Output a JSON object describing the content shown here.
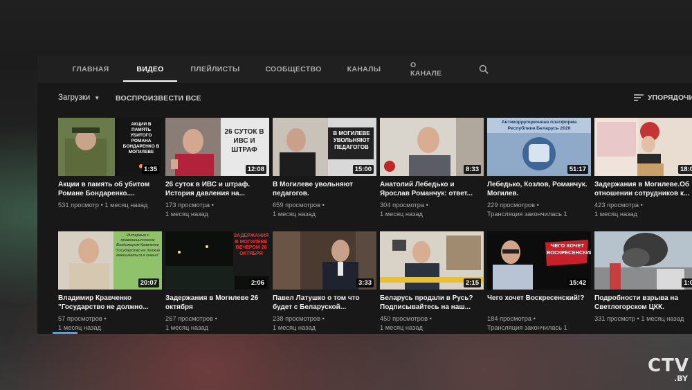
{
  "tabs": [
    {
      "label": "ГЛАВНАЯ",
      "active": false
    },
    {
      "label": "ВИДЕО",
      "active": true
    },
    {
      "label": "ПЛЕЙЛИСТЫ",
      "active": false
    },
    {
      "label": "СООБЩЕСТВО",
      "active": false
    },
    {
      "label": "КАНАЛЫ",
      "active": false
    },
    {
      "label": "О КАНАЛЕ",
      "active": false
    }
  ],
  "toolbar": {
    "uploads_label": "Загрузки",
    "play_all_label": "ВОСПРОИЗВЕСТИ ВСЕ",
    "sort_label": "УПОРЯДОЧИ"
  },
  "videos": [
    {
      "title": "Акции в память об убитом Романе Бондаренко....",
      "duration": "1:35",
      "meta1": "531 просмотр • 1 месяц назад",
      "meta2": "",
      "thumb_text": "Акции в память убитого РОМАНА БОНДАРЕНКО в Могилеве"
    },
    {
      "title": "26 суток в ИВС и штраф. История давления на...",
      "duration": "12:08",
      "meta1": "173 просмотра •",
      "meta2": "1 месяц назад",
      "thumb_text": "26 СУТОК В ИВС И ШТРАФ"
    },
    {
      "title": "В Могилеве увольняют педагогов.",
      "duration": "15:00",
      "meta1": "659 просмотров •",
      "meta2": "1 месяц назад",
      "thumb_text": "В МОГИЛЕВЕ УВОЛЬНЯЮТ ПЕДАГОГОВ"
    },
    {
      "title": "Анатолий Лебедько и Ярослав Романчук: ответ...",
      "duration": "8:33",
      "meta1": "304 просмотра •",
      "meta2": "1 месяц назад",
      "thumb_text": ""
    },
    {
      "title": "Лебедько, Козлов, Романчук. Могилев.",
      "duration": "51:17",
      "meta1": "229 просмотров •",
      "meta2": "Трансляция закончилась 1",
      "thumb_text": "Антикоррупционная платформа Республики Беларусь 2020"
    },
    {
      "title": "Задержания в Могилеве.Об отношении сотрудников к...",
      "duration": "18:0",
      "meta1": "423 просмотра •",
      "meta2": "1 месяц назад",
      "thumb_text": ""
    },
    {
      "title": "Владимир Кравченко \"Государство не должно...",
      "duration": "20:07",
      "meta1": "57 просмотров •",
      "meta2": "1 месяц назад",
      "thumb_text": "Интервью с правозащитником Владимиром Кравченко \"Государство не должно вмешиваться в семью\""
    },
    {
      "title": "Задержания в Могилеве 26 октября",
      "duration": "2:06",
      "meta1": "267 просмотров •",
      "meta2": "1 месяц назад",
      "thumb_text": "ЗАДЕРЖАНИЯ В МОГИЛЕВЕ ВЕЧЕРОМ 26 ОКТЯБРЯ"
    },
    {
      "title": "Павел Латушко о том что будет с Беларуской...",
      "duration": "3:33",
      "meta1": "238 просмотров •",
      "meta2": "1 месяц назад",
      "thumb_text": ""
    },
    {
      "title": "Беларусь продали в Русь? Подписывайтесь на наш...",
      "duration": "2:15",
      "meta1": "450 просмотров •",
      "meta2": "1 месяц назад",
      "thumb_text": ""
    },
    {
      "title": "Чего хочет Воскресенский!?",
      "duration": "15:42",
      "meta1": "184 просмотра •",
      "meta2": "Трансляция закончилась 1",
      "thumb_text": "ЧЕГО ХОЧЕТ ВОСКРЕСЕНСКИЙ!?"
    },
    {
      "title": "Подробности взрыва на Светлогорском ЦКК.",
      "duration": "1:0",
      "meta1": "331 просмотр • 1 месяц назад",
      "meta2": "",
      "thumb_text": ""
    }
  ],
  "watermark": {
    "main": "CTV",
    "sub": ".BY"
  },
  "colors": {
    "page_bg": "#181818",
    "tab_bar_bg": "#202020",
    "accent": "#3ea6ff"
  }
}
